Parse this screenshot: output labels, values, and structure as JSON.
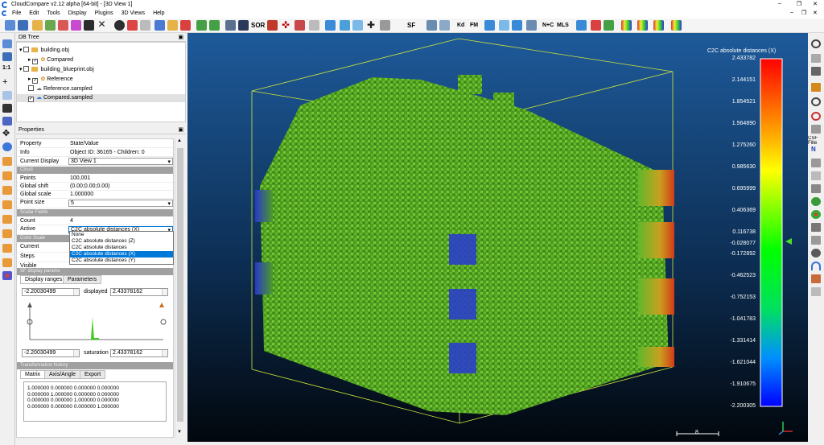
{
  "window": {
    "title": "CloudCompare v2.12 alpha [64-bit] - [3D View 1]"
  },
  "menu": [
    "File",
    "Edit",
    "Tools",
    "Display",
    "Plugins",
    "3D Views",
    "Help"
  ],
  "toolbar": {
    "sor_label": "SOR",
    "nc_label": "N+C",
    "mls_label": "MLS",
    "kd_label": "Kd",
    "fm_label": "FM",
    "sf_label": "SF"
  },
  "db_tree": {
    "title": "DB Tree",
    "items": [
      {
        "label": "building.obj",
        "level": 0
      },
      {
        "label": "Compared",
        "level": 1
      },
      {
        "label": "building_blueprint.obj",
        "level": 0
      },
      {
        "label": "Reference",
        "level": 1
      },
      {
        "label": "Reference.sampled",
        "level": 0
      },
      {
        "label": "Compared.sampled",
        "level": 0
      }
    ]
  },
  "properties": {
    "title": "Properties",
    "header_property": "Property",
    "header_value": "State/Value",
    "info_label": "Info",
    "info_value": "Object ID: 36165 - Children: 0",
    "display_label": "Current Display",
    "display_value": "3D View 1",
    "cloud_section": "Cloud",
    "points_label": "Points",
    "points_value": "100,001",
    "shift_label": "Global shift",
    "shift_value": "(0.00;0.00;0.00)",
    "scale_label": "Global scale",
    "scale_value": "1.000000",
    "pointsize_label": "Point size",
    "pointsize_value": "5",
    "sf_section": "Scalar Fields",
    "count_label": "Count",
    "count_value": "4",
    "active_label": "Active",
    "active_value": "C2C absolute distances (X)",
    "colorscale_section": "Color Scale",
    "current_label": "Current",
    "steps_label": "Steps",
    "visible_label": "Visible",
    "sfparams_section": "SF display params",
    "dropdown_options": [
      "None",
      "C2C absolute distances (Z)",
      "C2C absolute distances",
      "C2C absolute distances (X)",
      "C2C absolute distances (Y)"
    ],
    "dropdown_selected": 3,
    "tabs": [
      "Display ranges",
      "Parameters"
    ],
    "range_min": "-2.20030499",
    "displayed_label": "displayed",
    "displayed_value": "2.43378162",
    "sat_min": "-2.20030499",
    "saturation_label": "saturation",
    "saturation_value": "2.43378162",
    "transform_section": "Transformation history",
    "transform_tabs": [
      "Matrix",
      "Axis/Angle",
      "Export"
    ],
    "matrix": [
      "1.000000 0.000000 0.000000 0.000000",
      "0.000000 1.000000 0.000000 0.000000",
      "0.000000 0.000000 1.000000 0.000000",
      "0.000000 0.000000 0.000000 1.000000"
    ]
  },
  "scalebar": {
    "title": "C2C absolute distances (X)",
    "ticks": [
      "2.433782",
      "2.144151",
      "1.854521",
      "1.564890",
      "1.275260",
      "0.985630",
      "0.695999",
      "0.406369",
      "0.116738",
      "-0.028077",
      "-0.172892",
      "-0.462523",
      "-0.752153",
      "-1.041783",
      "-1.331414",
      "-1.621044",
      "-1.910675",
      "-2.200305"
    ]
  },
  "viewport": {
    "scale_label": "8"
  },
  "right_tools": {
    "csf_label": "CSF Filte"
  },
  "colors": {
    "accent": "#0078d7",
    "viewport_top": "#1e5a9a",
    "viewport_bottom": "#02070d",
    "points": "#5fb82a"
  }
}
